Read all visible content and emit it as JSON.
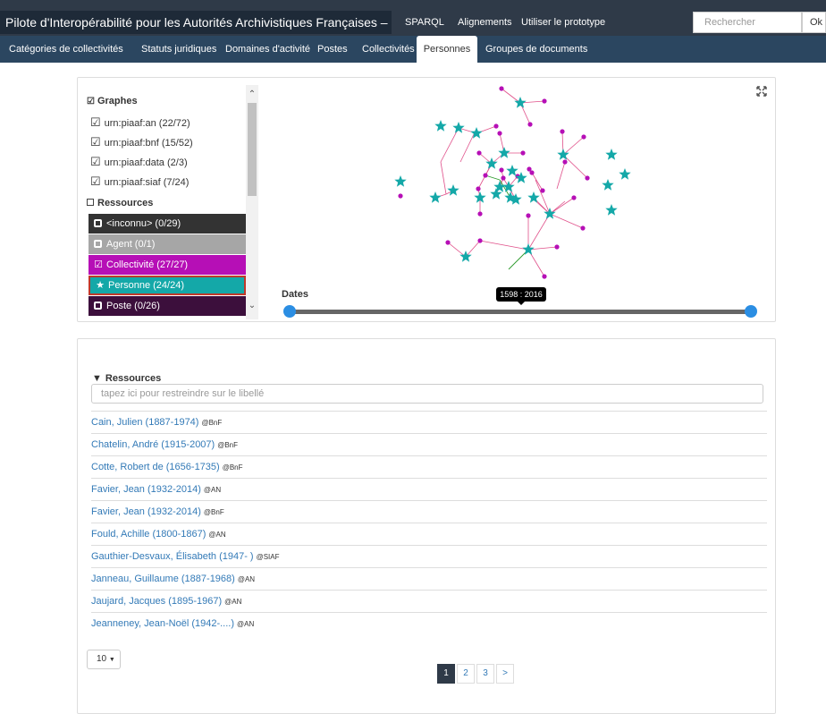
{
  "header": {
    "title": "Pilote d'Interopérabilité pour les Autorités Archivistiques Françaises – PIAAF",
    "links": [
      "SPARQL",
      "Alignements",
      "Utiliser le prototype"
    ],
    "search_placeholder": "Rechercher",
    "search_button": "Ok"
  },
  "subnav": {
    "items": [
      "Catégories de collectivités",
      "Statuts juridiques",
      "Domaines d'activité",
      "Postes",
      "Collectivités",
      "Personnes",
      "Groupes de documents"
    ],
    "active": "Personnes"
  },
  "sidebar": {
    "graphs_title": "Graphes",
    "graphs": [
      "urn:piaaf:an (22/72)",
      "urn:piaaf:bnf (15/52)",
      "urn:piaaf:data (2/3)",
      "urn:piaaf:siaf (7/24)"
    ],
    "resources_title": "Ressources",
    "resources": [
      {
        "label": "<inconnu> (0/29)",
        "color": "#333333",
        "checked": false
      },
      {
        "label": "Agent (0/1)",
        "color": "#a6a6a6",
        "checked": false
      },
      {
        "label": "Collectivité (27/27)",
        "color": "#b60fb6",
        "checked": true
      },
      {
        "label": "Personne (24/24)",
        "color": "#14a8a8",
        "checked": true
      },
      {
        "label": "Poste (0/26)",
        "color": "#3c0f3c",
        "checked": false
      }
    ]
  },
  "timeline": {
    "label": "Dates",
    "range_text": "1598 : 2016"
  },
  "graph_colors": {
    "collectivite": "#b60fb6",
    "personne": "#14a8a8",
    "edge": "#e0508a",
    "edge_alt": "#2a9a2a"
  },
  "resource_list": {
    "title": "Ressources",
    "filter_placeholder": "tapez ici pour restreindre sur le libellé",
    "rows": [
      {
        "name": "Cain, Julien (1887-1974)",
        "source": "@BnF"
      },
      {
        "name": "Chatelin, André (1915-2007)",
        "source": "@BnF"
      },
      {
        "name": "Cotte, Robert de (1656-1735)",
        "source": "@BnF"
      },
      {
        "name": "Favier, Jean (1932-2014)",
        "source": "@AN"
      },
      {
        "name": "Favier, Jean (1932-2014)",
        "source": "@BnF"
      },
      {
        "name": "Fould, Achille (1800-1867)",
        "source": "@AN"
      },
      {
        "name": "Gauthier-Desvaux, Élisabeth (1947- )",
        "source": "@SIAF"
      },
      {
        "name": "Janneau, Guillaume (1887-1968)",
        "source": "@AN"
      },
      {
        "name": "Jaujard, Jacques (1895-1967)",
        "source": "@AN"
      },
      {
        "name": "Jeanneney, Jean-Noël (1942-....)",
        "source": "@AN"
      }
    ],
    "page_size": "10",
    "pages": [
      "1",
      "2",
      "3",
      ">"
    ],
    "current_page": "1"
  }
}
